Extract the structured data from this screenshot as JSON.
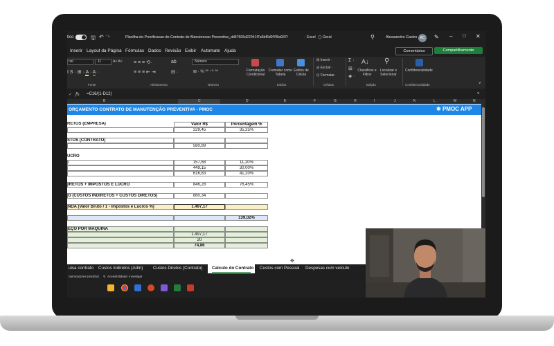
{
  "titlebar": {
    "autosave_label": "tico",
    "filename": "Planilha-de-Precificacao-de-Contrato-de-Manutencao-Preventiva_dd67605d22041f7a6bf6d0f7f8a937f",
    "app": "Excel",
    "sensitivity": "Geral",
    "user": "Alessandro Castro",
    "user_initials": "AC"
  },
  "menu": {
    "items": [
      "Inserir",
      "Layout da Página",
      "Fórmulas",
      "Dados",
      "Revisão",
      "Exibir",
      "Automate",
      "Ajuda"
    ],
    "comments_label": "Comentários",
    "share_label": "Compartilhamento"
  },
  "ribbon": {
    "font_name": "rial",
    "font_size": "11",
    "number_format": "Número",
    "cond_format": "Formatação Condicional",
    "format_table": "Formatar como Tabela",
    "cell_styles": "Estilos de Célula",
    "insert": "Inserir",
    "delete": "Excluir",
    "format": "Formatar",
    "sort_filter": "Classificar e Filtrar",
    "find_select": "Localizar e Selecionar",
    "confidentiality": "Confidencialidade",
    "groups": {
      "fonte": "Fonte",
      "alinhamento": "Alinhamento",
      "numero": "Número",
      "estilos": "Estilos",
      "celulas": "Células",
      "edicao": "Edição",
      "confidencialidade": "Confidencialidade"
    }
  },
  "formula_bar": {
    "fx": "fx",
    "formula": "=C16/(1-D12)"
  },
  "columns": [
    "B",
    "C",
    "D",
    "E",
    "F",
    "G",
    "H",
    "I",
    "J",
    "K",
    "L",
    "M",
    "N"
  ],
  "sheet": {
    "banner_title": "ORÇAMENTO CONTRATO DE MANUTENÇÃO PREVENTIVA - PMOC",
    "banner_logo": "PMOC APP",
    "header_valor": "Valor R$",
    "header_pct": "Porcentagem %",
    "s1_label": "RETOS (EMPRESA)",
    "s1_value": "229,45",
    "s1_pct": "35,25%",
    "s2_label": "STOS (CONTRATO)",
    "s2_value": "580,89",
    "s3_label": "UCRO",
    "s3_row1_label": "I",
    "s3_row1_value": "157,68",
    "s3_row1_pct": "11,20%",
    "s3_row2_value": "449,15",
    "s3_row2_pct": "30,00%",
    "s3_row3_value": "616,83",
    "s3_row3_pct": "41,20%",
    "s4_label": "IRETOS + IMPOSTOS E LUCRO",
    "s4_value": "846,28",
    "s4_pct": "76,45%",
    "s5_label": "O (CUSTOS INDIRETOS + CUSTOS DIRETOS)",
    "s5_value": "880,34",
    "s6_label": "NDA (Valor Bruto / 1 - Impostos e Lucros %)",
    "s6_value": "1.497,17",
    "s7_pct": "139,02%",
    "s8_label": "EÇO POR MAQUINA",
    "s8_row1_value": "1.497,17",
    "s8_row2_value": "20",
    "s8_row3_value": "74,86"
  },
  "tabs": [
    "uisa contrato",
    "Custos Indiretos (Adm)",
    "Custos Diretos (Contrato)",
    "Calculo do Contrato",
    "Custos com Pessoal",
    "Despesas com veículo"
  ],
  "active_tab": "Calculo do Contrato",
  "status": {
    "left": "namizadores (restrito)",
    "accessibility": "Acessibilidade: investigar"
  },
  "colors": {
    "banner": "#1d86e6",
    "highlight_yellow": "#fdefc4",
    "light_blue": "#dde8f6",
    "light_green": "#e3efd9",
    "excel_green": "#1e7e3a"
  }
}
